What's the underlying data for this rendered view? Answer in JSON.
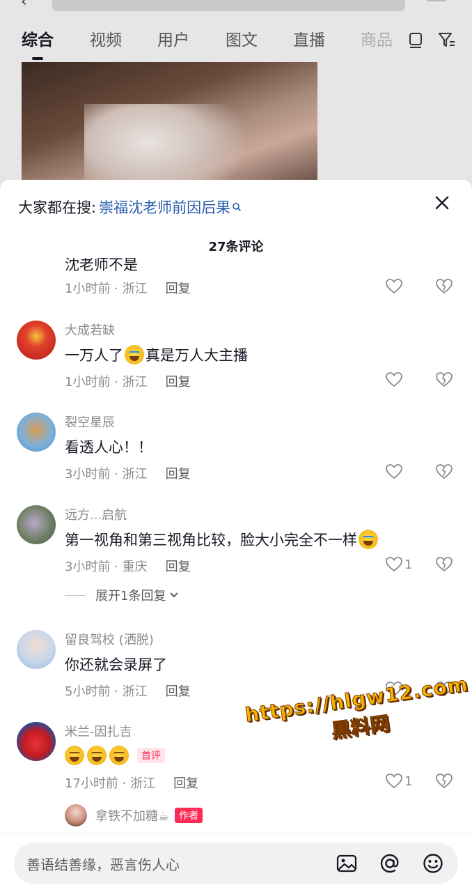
{
  "background": {
    "tabs": [
      {
        "label": "综合",
        "active": true
      },
      {
        "label": "视频",
        "active": false
      },
      {
        "label": "用户",
        "active": false
      },
      {
        "label": "图文",
        "active": false
      },
      {
        "label": "直播",
        "active": false
      },
      {
        "label": "商品",
        "active": false
      }
    ]
  },
  "sheet": {
    "hot_search_prefix": "大家都在搜:",
    "hot_search_term": "崇福沈老师前因后果",
    "comment_count_title": "27条评论",
    "cut_text": "沈老师不是"
  },
  "comments": [
    {
      "time_loc": "1小时前 · 浙江",
      "reply": "回复",
      "likes": ""
    },
    {
      "username": "大成若缺",
      "text_before": "一万人了",
      "text_after": "真是万人大主播",
      "emoji": "cry",
      "time_loc": "1小时前 · 浙江",
      "reply": "回复",
      "likes": ""
    },
    {
      "username": "裂空星辰",
      "text": "看透人心！！",
      "time_loc": "3小时前 · 浙江",
      "reply": "回复",
      "likes": ""
    },
    {
      "username": "远方...启航",
      "text": "第一视角和第三视角比较，脸大小完全不一样",
      "emoji": "cry",
      "time_loc": "3小时前 · 重庆",
      "reply": "回复",
      "likes": "1",
      "expand": "展开1条回复"
    },
    {
      "username": "留良驾校 (洒脱)",
      "text": "你还就会录屏了",
      "time_loc": "5小时前 · 浙江",
      "reply": "回复",
      "likes": ""
    },
    {
      "username": "米兰-因扎吉",
      "badge": "首评",
      "time_loc": "17小时前 · 浙江",
      "reply": "回复",
      "likes": "1",
      "sub_reply": {
        "name": "拿铁不加糖☕",
        "badge": "作者"
      }
    }
  ],
  "input": {
    "placeholder": "善语结善缘，恶言伤人心"
  },
  "watermark": {
    "url": "https://hlgw12.com",
    "name": "黑料网"
  },
  "colors": {
    "link": "#2a5db0",
    "accent": "#fe2c55",
    "secondary_text": "#8a8b91"
  }
}
